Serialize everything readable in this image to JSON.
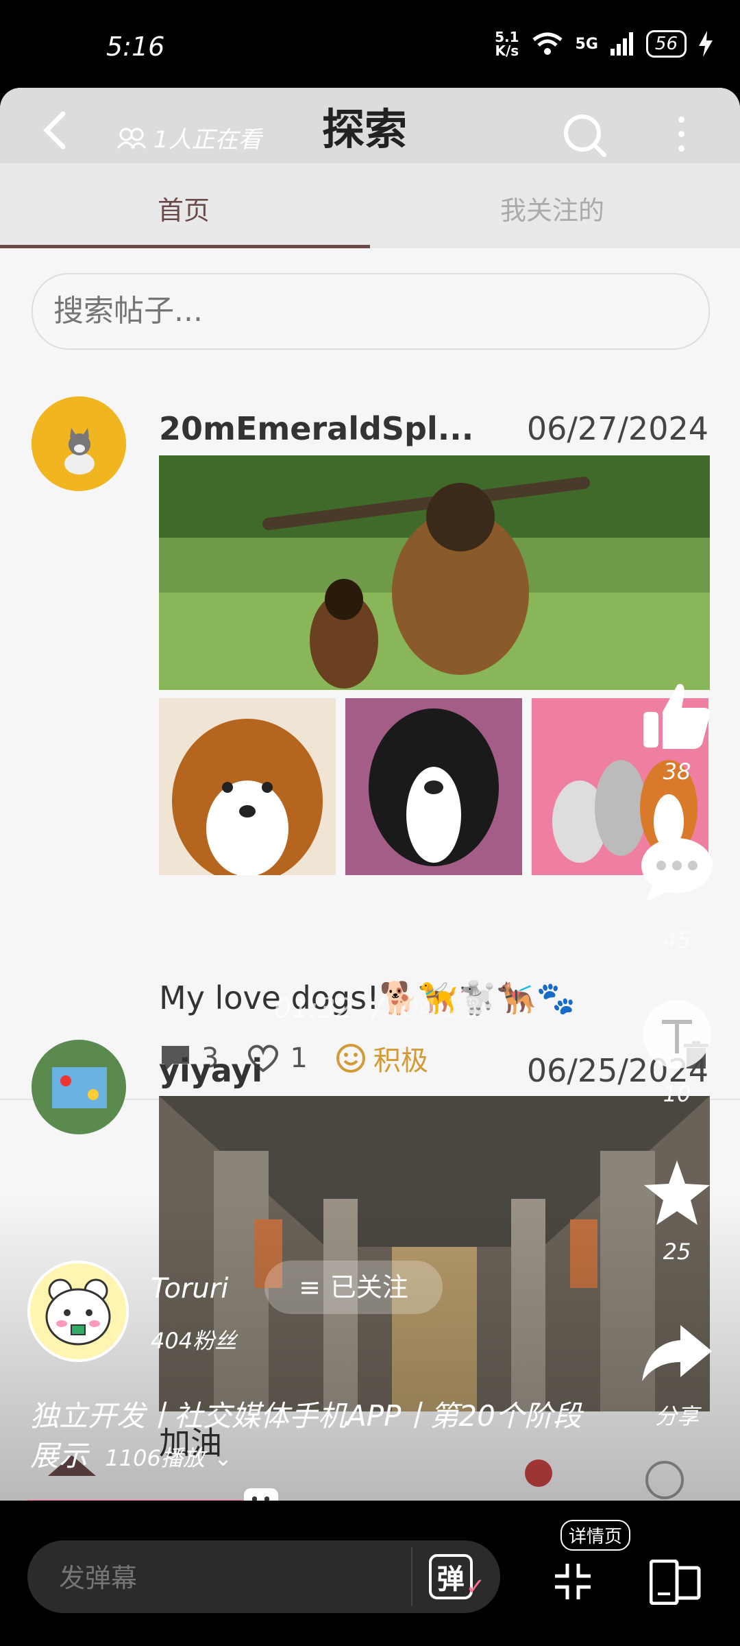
{
  "status_bar": {
    "time": "5:16",
    "speed_top": "5.1",
    "speed_bottom": "K/s",
    "network": "5G",
    "battery": "56"
  },
  "header": {
    "viewers": "1人正在看",
    "title": "探索"
  },
  "tabs": {
    "home": "首页",
    "following": "我关注的"
  },
  "search": {
    "placeholder": "搜索帖子..."
  },
  "posts": [
    {
      "username": "20mEmeraldSpl...",
      "date": "06/27/2024",
      "caption": "My love dogs!🐕🦮🐩🐕‍🦺🐾",
      "comments": "3",
      "likes": "1",
      "mood": "积极"
    },
    {
      "username": "yiyayi",
      "date": "06/25/2024",
      "caption": "加油"
    }
  ],
  "video_overlay": {
    "current_time": "01:32",
    "separator": "/",
    "total_time": "04:23",
    "creator_name": "Toruri",
    "follow_state": "已关注",
    "fans": "404粉丝",
    "title": "独立开发丨社交媒体手机APP丨第20个阶段展示",
    "plays": "1106播放",
    "likes": "38",
    "comments": "45",
    "coins": "10",
    "favorites": "25",
    "share": "分享",
    "progress_fraction": 0.35
  },
  "bottom_bar": {
    "danmu_placeholder": "发弹幕",
    "danmu_button": "弹",
    "detail": "详情页"
  }
}
